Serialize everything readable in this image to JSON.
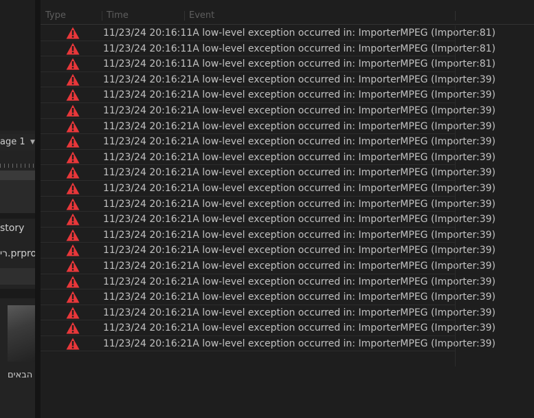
{
  "left_panel": {
    "sequence_label": "age 1",
    "history_label": "story",
    "project_file_label": "רי.prpro",
    "thumbnail_label": "הבאים"
  },
  "events_panel": {
    "columns": [
      "Type",
      "Time",
      "Event"
    ],
    "rows": [
      {
        "time": "11/23/24 20:16:11A",
        "event": "low-level exception occurred in: ImporterMPEG (Importer:81)"
      },
      {
        "time": "11/23/24 20:16:11A",
        "event": "low-level exception occurred in: ImporterMPEG (Importer:81)"
      },
      {
        "time": "11/23/24 20:16:11A",
        "event": "low-level exception occurred in: ImporterMPEG (Importer:81)"
      },
      {
        "time": "11/23/24 20:16:21A",
        "event": "low-level exception occurred in: ImporterMPEG (Importer:39)"
      },
      {
        "time": "11/23/24 20:16:21A",
        "event": "low-level exception occurred in: ImporterMPEG (Importer:39)"
      },
      {
        "time": "11/23/24 20:16:21A",
        "event": "low-level exception occurred in: ImporterMPEG (Importer:39)"
      },
      {
        "time": "11/23/24 20:16:21A",
        "event": "low-level exception occurred in: ImporterMPEG (Importer:39)"
      },
      {
        "time": "11/23/24 20:16:21A",
        "event": "low-level exception occurred in: ImporterMPEG (Importer:39)"
      },
      {
        "time": "11/23/24 20:16:21A",
        "event": "low-level exception occurred in: ImporterMPEG (Importer:39)"
      },
      {
        "time": "11/23/24 20:16:21A",
        "event": "low-level exception occurred in: ImporterMPEG (Importer:39)"
      },
      {
        "time": "11/23/24 20:16:21A",
        "event": "low-level exception occurred in: ImporterMPEG (Importer:39)"
      },
      {
        "time": "11/23/24 20:16:21A",
        "event": "low-level exception occurred in: ImporterMPEG (Importer:39)"
      },
      {
        "time": "11/23/24 20:16:21A",
        "event": "low-level exception occurred in: ImporterMPEG (Importer:39)"
      },
      {
        "time": "11/23/24 20:16:21A",
        "event": "low-level exception occurred in: ImporterMPEG (Importer:39)"
      },
      {
        "time": "11/23/24 20:16:21A",
        "event": "low-level exception occurred in: ImporterMPEG (Importer:39)"
      },
      {
        "time": "11/23/24 20:16:21A",
        "event": "low-level exception occurred in: ImporterMPEG (Importer:39)"
      },
      {
        "time": "11/23/24 20:16:21A",
        "event": "low-level exception occurred in: ImporterMPEG (Importer:39)"
      },
      {
        "time": "11/23/24 20:16:21A",
        "event": "low-level exception occurred in: ImporterMPEG (Importer:39)"
      },
      {
        "time": "11/23/24 20:16:21A",
        "event": "low-level exception occurred in: ImporterMPEG (Importer:39)"
      },
      {
        "time": "11/23/24 20:16:21A",
        "event": "low-level exception occurred in: ImporterMPEG (Importer:39)"
      },
      {
        "time": "11/23/24 20:16:21A",
        "event": "low-level exception occurred in: ImporterMPEG (Importer:39)"
      }
    ],
    "row_icon": "warning-triangle-icon",
    "warning_color": "#e8373a"
  }
}
